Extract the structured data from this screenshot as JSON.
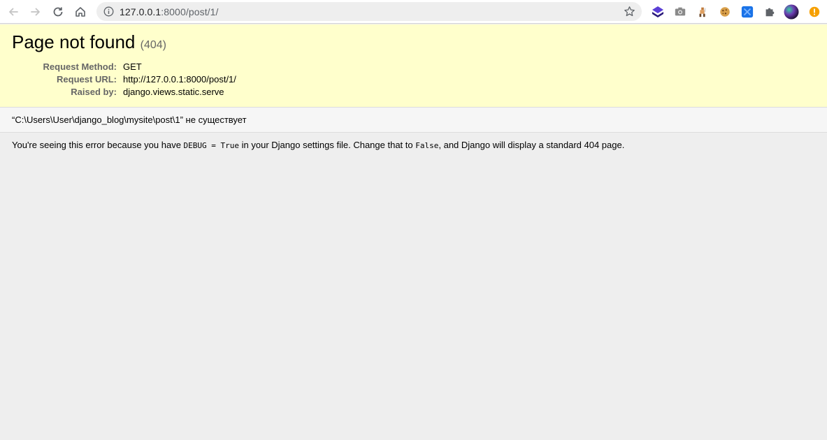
{
  "browser": {
    "url_host": "127.0.0.1",
    "url_rest": ":8000/post/1/",
    "icons": [
      "back-arrow-icon",
      "forward-arrow-icon",
      "reload-icon",
      "home-icon",
      "info-icon",
      "star-icon",
      "extension-stack-icon",
      "camera-icon",
      "extension-figure-icon",
      "cookie-icon",
      "extension-blue-icon",
      "puzzle-icon",
      "profile-avatar-icon",
      "update-alert-icon"
    ],
    "colors": {
      "toolbar_bg": "#ffffff",
      "omnibox_bg": "#eeeeee",
      "alert": "#f6a000",
      "extension_purple": "#3b2a9e",
      "extension_blue": "#1a73e8"
    }
  },
  "error": {
    "title": "Page not found",
    "code": "(404)",
    "details": [
      {
        "label": "Request Method:",
        "value": "GET"
      },
      {
        "label": "Request URL:",
        "value": "http://127.0.0.1:8000/post/1/"
      },
      {
        "label": "Raised by:",
        "value": "django.views.static.serve"
      }
    ],
    "message": "“C:\\Users\\User\\django_blog\\mysite\\post\\1” не существует",
    "explanation": {
      "part1": "You're seeing this error because you have ",
      "code1": "DEBUG = True",
      "part2": " in your Django settings file. Change that to ",
      "code2": "False",
      "part3": ", and Django will display a standard 404 page."
    },
    "colors": {
      "summary_bg": "#ffffcc",
      "info_bg": "#f6f6f6",
      "page_bg": "#eeeeee",
      "label": "#666666"
    }
  }
}
